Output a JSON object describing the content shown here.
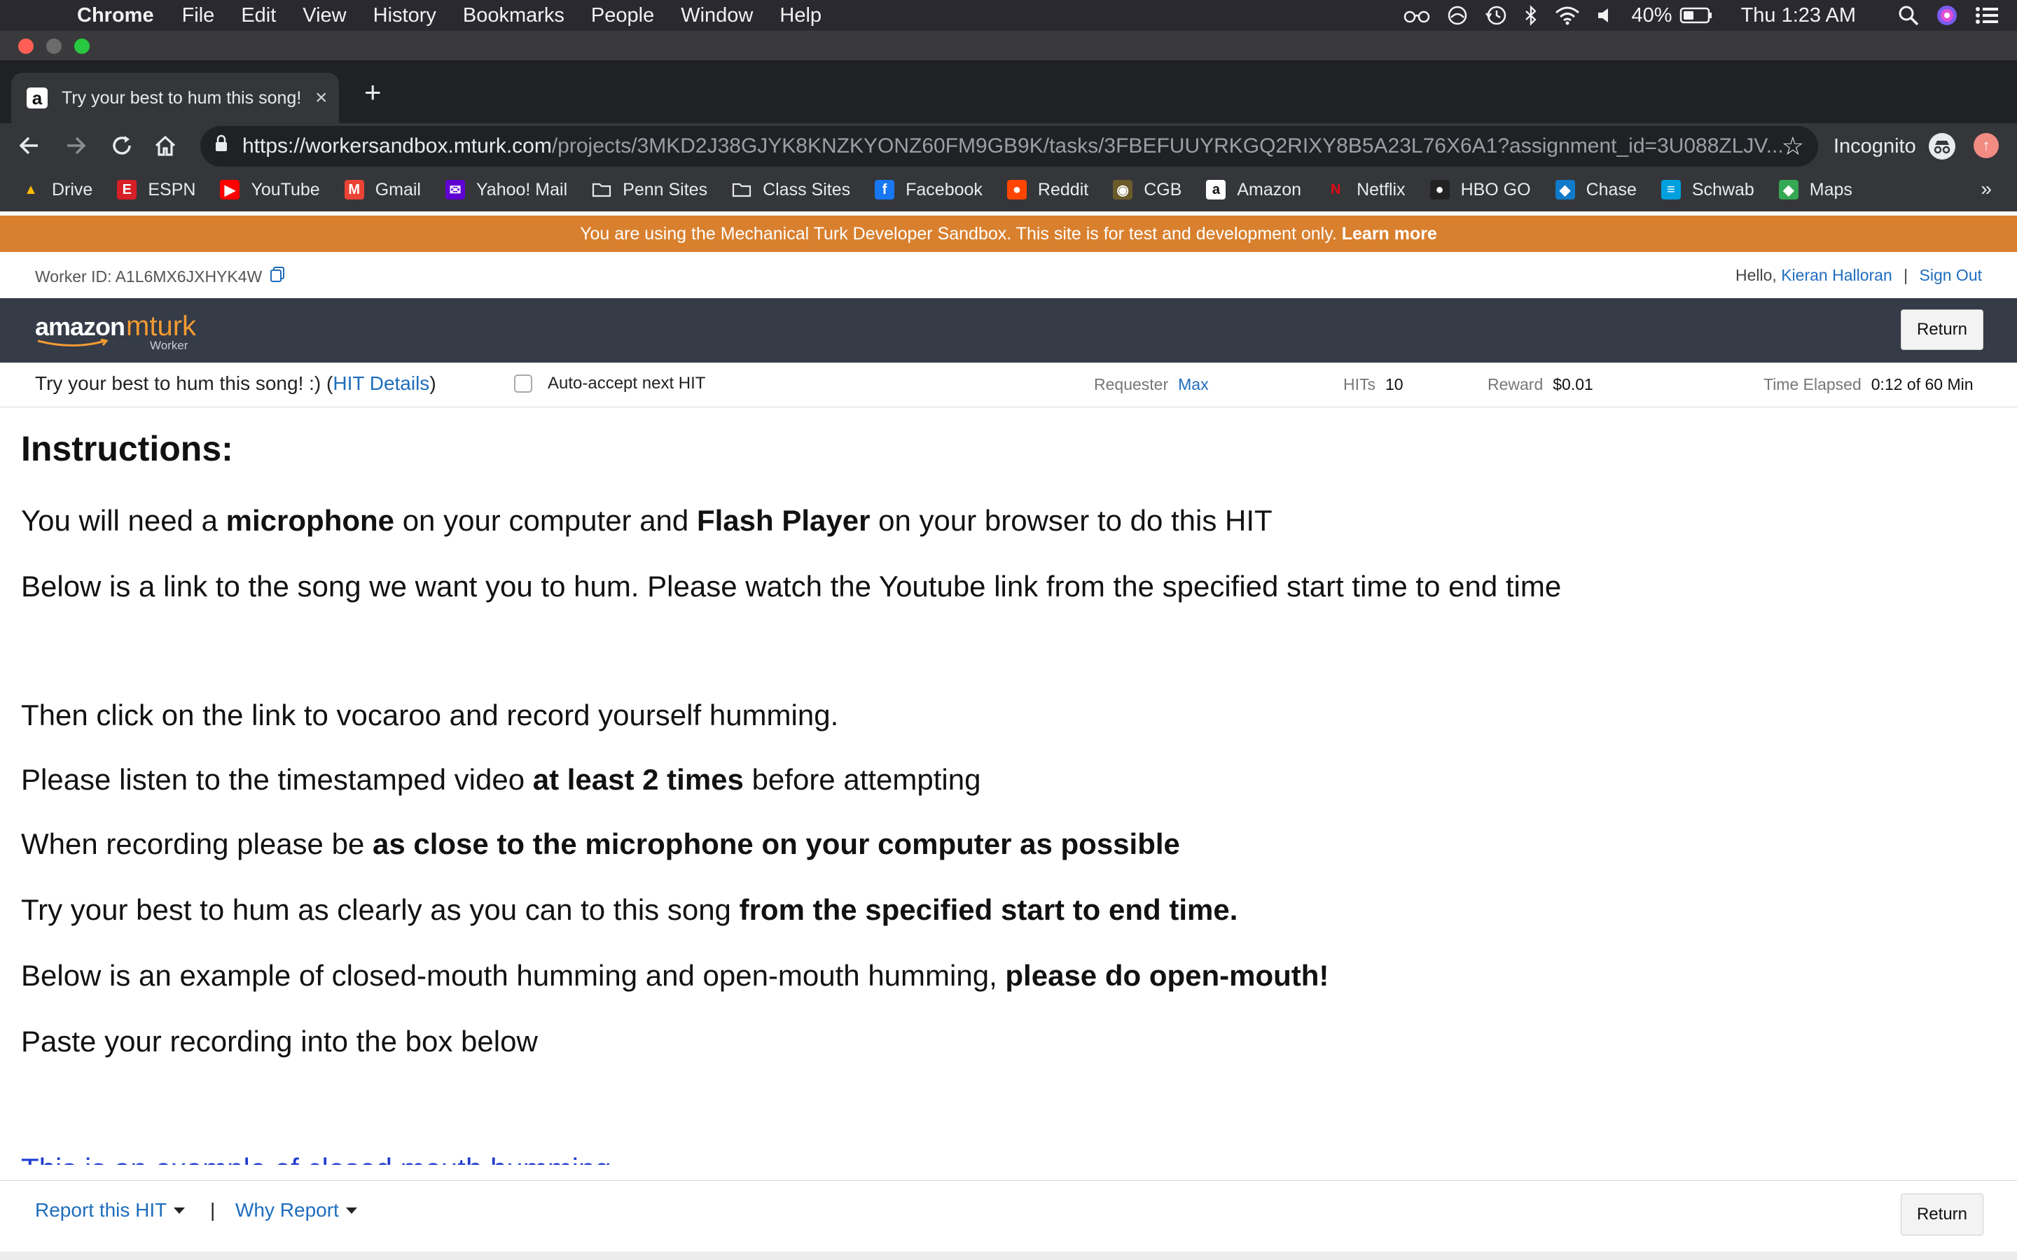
{
  "macos_menubar": {
    "app_name": "Chrome",
    "menus": [
      "File",
      "Edit",
      "View",
      "History",
      "Bookmarks",
      "People",
      "Window",
      "Help"
    ],
    "battery_percent": "40%",
    "clock": "Thu 1:23 AM"
  },
  "browser": {
    "tab_title": "Try your best to hum this song! :)",
    "url_host": "https://workersandbox.mturk.com",
    "url_path": "/projects/3MKD2J38GJYK8KNZKYONZ60FM9GB9K/tasks/3FBEFUUYRKGQ2RIXY8B5A23L76X6A1?assignment_id=3U088ZLJV...",
    "incognito_label": "Incognito",
    "bookmarks": [
      {
        "label": "Drive",
        "color": "#34a853",
        "glyph": "▲"
      },
      {
        "label": "ESPN",
        "color": "#d61f26",
        "glyph": "E"
      },
      {
        "label": "YouTube",
        "color": "#ff0000",
        "glyph": "▶"
      },
      {
        "label": "Gmail",
        "color": "#ea4335",
        "glyph": "M"
      },
      {
        "label": "Yahoo! Mail",
        "color": "#6001d2",
        "glyph": "✉"
      },
      {
        "label": "Penn Sites",
        "color": "transparent",
        "glyph": "folder"
      },
      {
        "label": "Class Sites",
        "color": "transparent",
        "glyph": "folder"
      },
      {
        "label": "Facebook",
        "color": "#1877f2",
        "glyph": "f"
      },
      {
        "label": "Reddit",
        "color": "#ff4500",
        "glyph": "●"
      },
      {
        "label": "CGB",
        "color": "#6b5a2a",
        "glyph": "◉"
      },
      {
        "label": "Amazon",
        "color": "#ffffff",
        "glyph": "a"
      },
      {
        "label": "Netflix",
        "color": "transparent",
        "glyph": "N"
      },
      {
        "label": "HBO GO",
        "color": "#222222",
        "glyph": "●"
      },
      {
        "label": "Chase",
        "color": "#117aca",
        "glyph": "◆"
      },
      {
        "label": "Schwab",
        "color": "#00a0df",
        "glyph": "≡"
      },
      {
        "label": "Maps",
        "color": "#34a853",
        "glyph": "◆"
      }
    ],
    "bookmarks_overflow": "»"
  },
  "sandbox_banner": {
    "text": "You are using the Mechanical Turk Developer Sandbox. This site is for test and development only.",
    "link": "Learn more"
  },
  "worker_bar": {
    "worker_id": "Worker ID: A1L6MX6JXHYK4W",
    "hello": "Hello,",
    "user_name": "Kieran Halloran",
    "separator": "|",
    "sign_out": "Sign Out"
  },
  "mturk_nav": {
    "logo_amazon": "amazon",
    "logo_mturk": "mturk",
    "logo_worker": "Worker",
    "return_label": "Return"
  },
  "hit_info": {
    "title": "Try your best to hum this song! :)",
    "details_open": " (",
    "details_link": "HIT Details",
    "details_close": ")",
    "auto_accept": "Auto-accept next HIT",
    "auto_accept_checked": false,
    "requester_label": "Requester",
    "requester_value": "Max",
    "hits_label": "HITs",
    "hits_value": "10",
    "reward_label": "Reward",
    "reward_value": "$0.01",
    "time_label": "Time Elapsed",
    "time_value": "0:12 of 60 Min"
  },
  "instructions": {
    "heading": "Instructions:",
    "line1": {
      "a": "You will need a ",
      "b": "microphone",
      "c": " on your computer and ",
      "d": "Flash Player",
      "e": " on your browser to do this HIT"
    },
    "line2": "Below is a link to the song we want you to hum. Please watch the Youtube link from the specified start time to end time",
    "line3": "Then click on the link to vocaroo and record yourself humming.",
    "line4": {
      "a": "Please listen to the timestamped video ",
      "b": "at least 2 times",
      "c": " before attempting"
    },
    "line5": {
      "a": "When recording please be ",
      "b": "as close to the microphone on your computer as possible"
    },
    "line6": {
      "a": "Try your best to hum as clearly as you can to this song ",
      "b": "from the specified start to end time."
    },
    "line7": {
      "a": "Below is an example of closed-mouth humming and open-mouth humming, ",
      "b": "please do open-mouth!"
    },
    "line8": "Paste your recording into the box below",
    "cut_link": "This is an example of closed mouth humming"
  },
  "footer": {
    "report_hit": "Report this HIT",
    "separator": "|",
    "why_report": "Why Report",
    "return_label": "Return"
  }
}
